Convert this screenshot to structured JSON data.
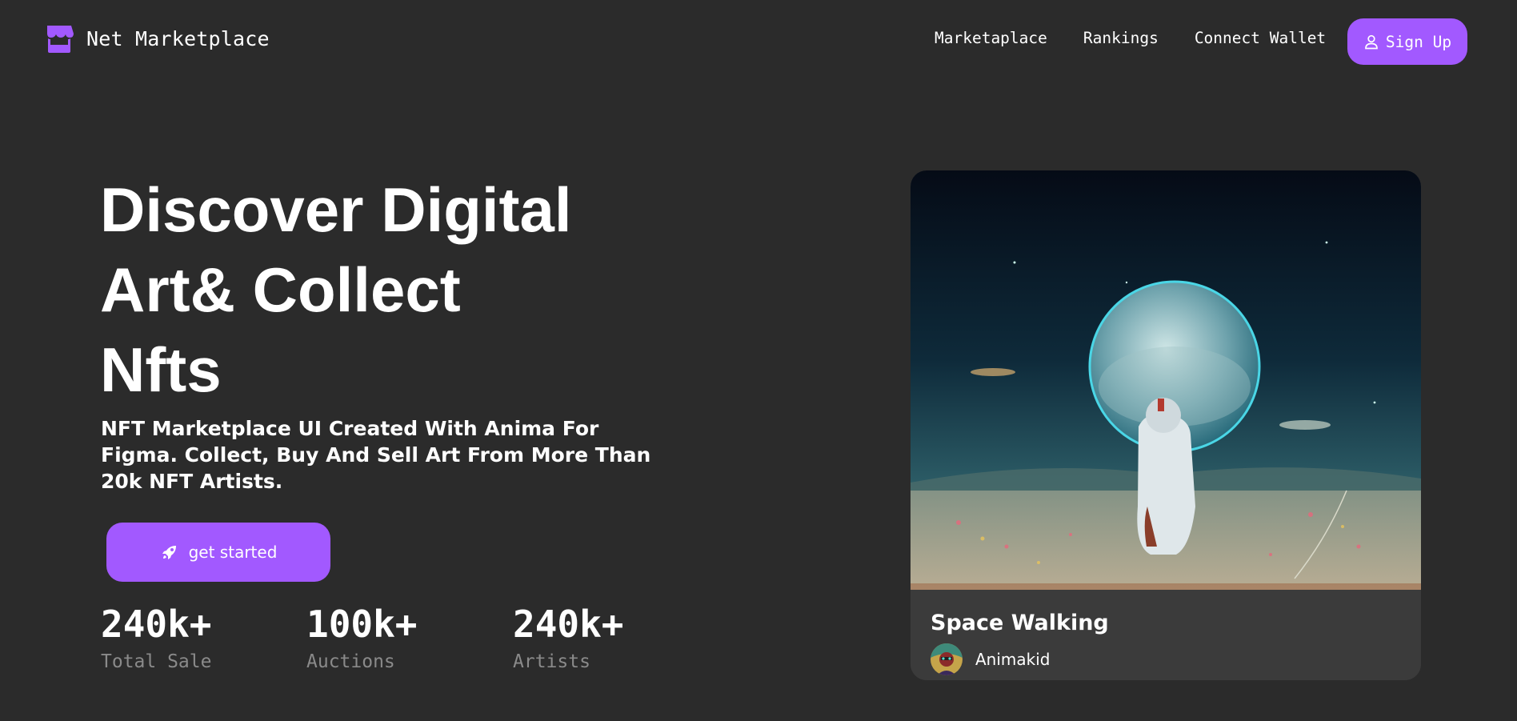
{
  "brand": {
    "name": "Net Marketplace",
    "icon": "storefront-icon",
    "color": "#a259ff"
  },
  "nav": {
    "items": [
      "Marketaplace",
      "Rankings",
      "Connect Wallet"
    ],
    "signup_label": "Sign Up",
    "signup_icon": "user-icon"
  },
  "hero": {
    "title_line1": "Discover Digital",
    "title_line2": "Art& Collect",
    "title_line3": "Nfts",
    "subtitle": "NFT Marketplace UI Created With Anima For Figma. Collect, Buy And Sell Art From More Than 20k NFT Artists.",
    "cta_label": "get started",
    "cta_icon": "rocket-icon"
  },
  "stats": [
    {
      "value": "240k+",
      "label": "Total Sale"
    },
    {
      "value": "100k+",
      "label": "Auctions"
    },
    {
      "value": "240k+",
      "label": "Artists"
    }
  ],
  "featured": {
    "title": "Space Walking",
    "creator": "Animakid"
  },
  "colors": {
    "background": "#2b2b2b",
    "card": "#3b3b3b",
    "accent": "#a259ff",
    "muted": "#8a8a8a"
  }
}
